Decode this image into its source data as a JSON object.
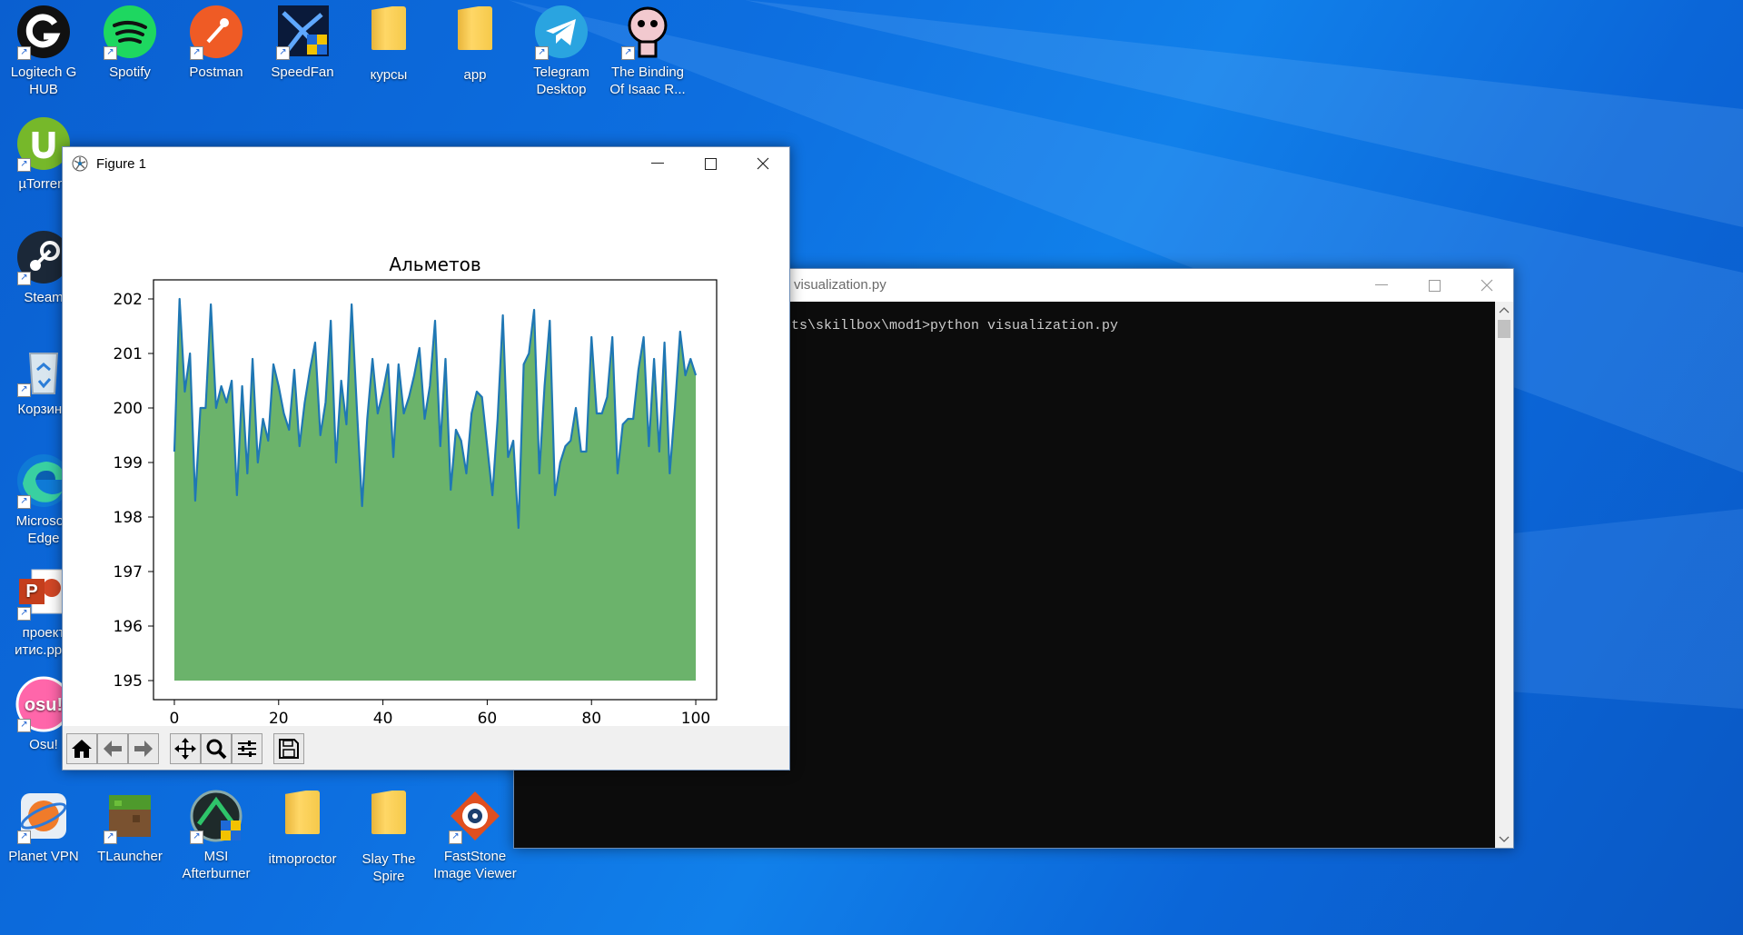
{
  "desktop": {
    "icons": [
      {
        "label": "Logitech G HUB",
        "icon": "logitech-icon"
      },
      {
        "label": "Spotify",
        "icon": "spotify-icon"
      },
      {
        "label": "Postman",
        "icon": "postman-icon"
      },
      {
        "label": "SpeedFan",
        "icon": "speedfan-icon"
      },
      {
        "label": "курсы",
        "icon": "folder-icon"
      },
      {
        "label": "app",
        "icon": "folder-icon"
      },
      {
        "label": "Telegram Desktop",
        "icon": "telegram-icon"
      },
      {
        "label": "The Binding Of Isaac R...",
        "icon": "isaac-icon"
      },
      {
        "label": "µTorrent",
        "icon": "utorrent-icon"
      },
      {
        "label": "Steam",
        "icon": "steam-icon"
      },
      {
        "label": "Корзина",
        "icon": "recycle-bin-icon"
      },
      {
        "label": "Microsoft Edge",
        "icon": "edge-icon"
      },
      {
        "label": "проект итис.pptx",
        "icon": "powerpoint-icon"
      },
      {
        "label": "Osu!",
        "icon": "osu-icon"
      },
      {
        "label": "Planet VPN",
        "icon": "planet-vpn-icon"
      },
      {
        "label": "TLauncher",
        "icon": "tlauncher-icon"
      },
      {
        "label": "MSI Afterburner",
        "icon": "msi-afterburner-icon"
      },
      {
        "label": "itmoproctor",
        "icon": "folder-icon"
      },
      {
        "label": "Slay The Spire",
        "icon": "folder-icon"
      },
      {
        "label": "FastStone Image Viewer",
        "icon": "faststone-icon"
      }
    ]
  },
  "figure_window": {
    "title": "Figure 1",
    "toolbar": [
      "home",
      "back",
      "forward",
      "pan",
      "zoom",
      "configure",
      "save"
    ]
  },
  "console_window": {
    "title": "visualization.py",
    "line": "ts\\skillbox\\mod1>python visualization.py"
  },
  "chart_data": {
    "type": "area",
    "title": "Альметов",
    "xlabel": "",
    "ylabel": "",
    "xlim": [
      -4,
      104
    ],
    "ylim": [
      194.65,
      202.35
    ],
    "xticks": [
      0,
      20,
      40,
      60,
      80,
      100
    ],
    "yticks": [
      195,
      196,
      197,
      198,
      199,
      200,
      201,
      202
    ],
    "fill_base": 195,
    "line_color": "#1f77b4",
    "fill_color": "#6bb36b",
    "x_start": 0,
    "x_step": 1,
    "values": [
      199.2,
      202.0,
      200.3,
      201.0,
      198.3,
      200.0,
      200.0,
      201.9,
      200.0,
      200.4,
      200.1,
      200.5,
      198.4,
      200.4,
      198.8,
      200.9,
      199.0,
      199.8,
      199.4,
      200.8,
      200.4,
      199.9,
      199.6,
      200.7,
      199.3,
      200.1,
      200.7,
      201.2,
      199.5,
      200.1,
      201.6,
      199.0,
      200.5,
      199.7,
      201.9,
      200.0,
      198.2,
      199.8,
      200.9,
      199.9,
      200.3,
      200.8,
      199.1,
      200.8,
      199.9,
      200.2,
      200.6,
      201.1,
      199.8,
      200.4,
      201.6,
      199.3,
      200.9,
      198.5,
      199.6,
      199.4,
      198.8,
      199.9,
      200.3,
      200.2,
      199.3,
      198.4,
      199.8,
      201.7,
      199.1,
      199.4,
      197.8,
      200.8,
      201.0,
      201.8,
      198.8,
      200.4,
      201.6,
      198.4,
      199.0,
      199.3,
      199.4,
      200.0,
      199.2,
      199.2,
      201.3,
      199.9,
      199.9,
      200.2,
      201.3,
      198.8,
      199.7,
      199.8,
      199.8,
      200.7,
      201.3,
      199.3,
      200.9,
      199.2,
      201.2,
      198.8,
      200.0,
      201.4,
      200.6,
      200.9,
      200.6
    ]
  },
  "colors": {
    "desktop_blue": "#0d6fe0",
    "console_bg": "#0c0c0c",
    "toolbar_bg": "#f0f0f0"
  }
}
